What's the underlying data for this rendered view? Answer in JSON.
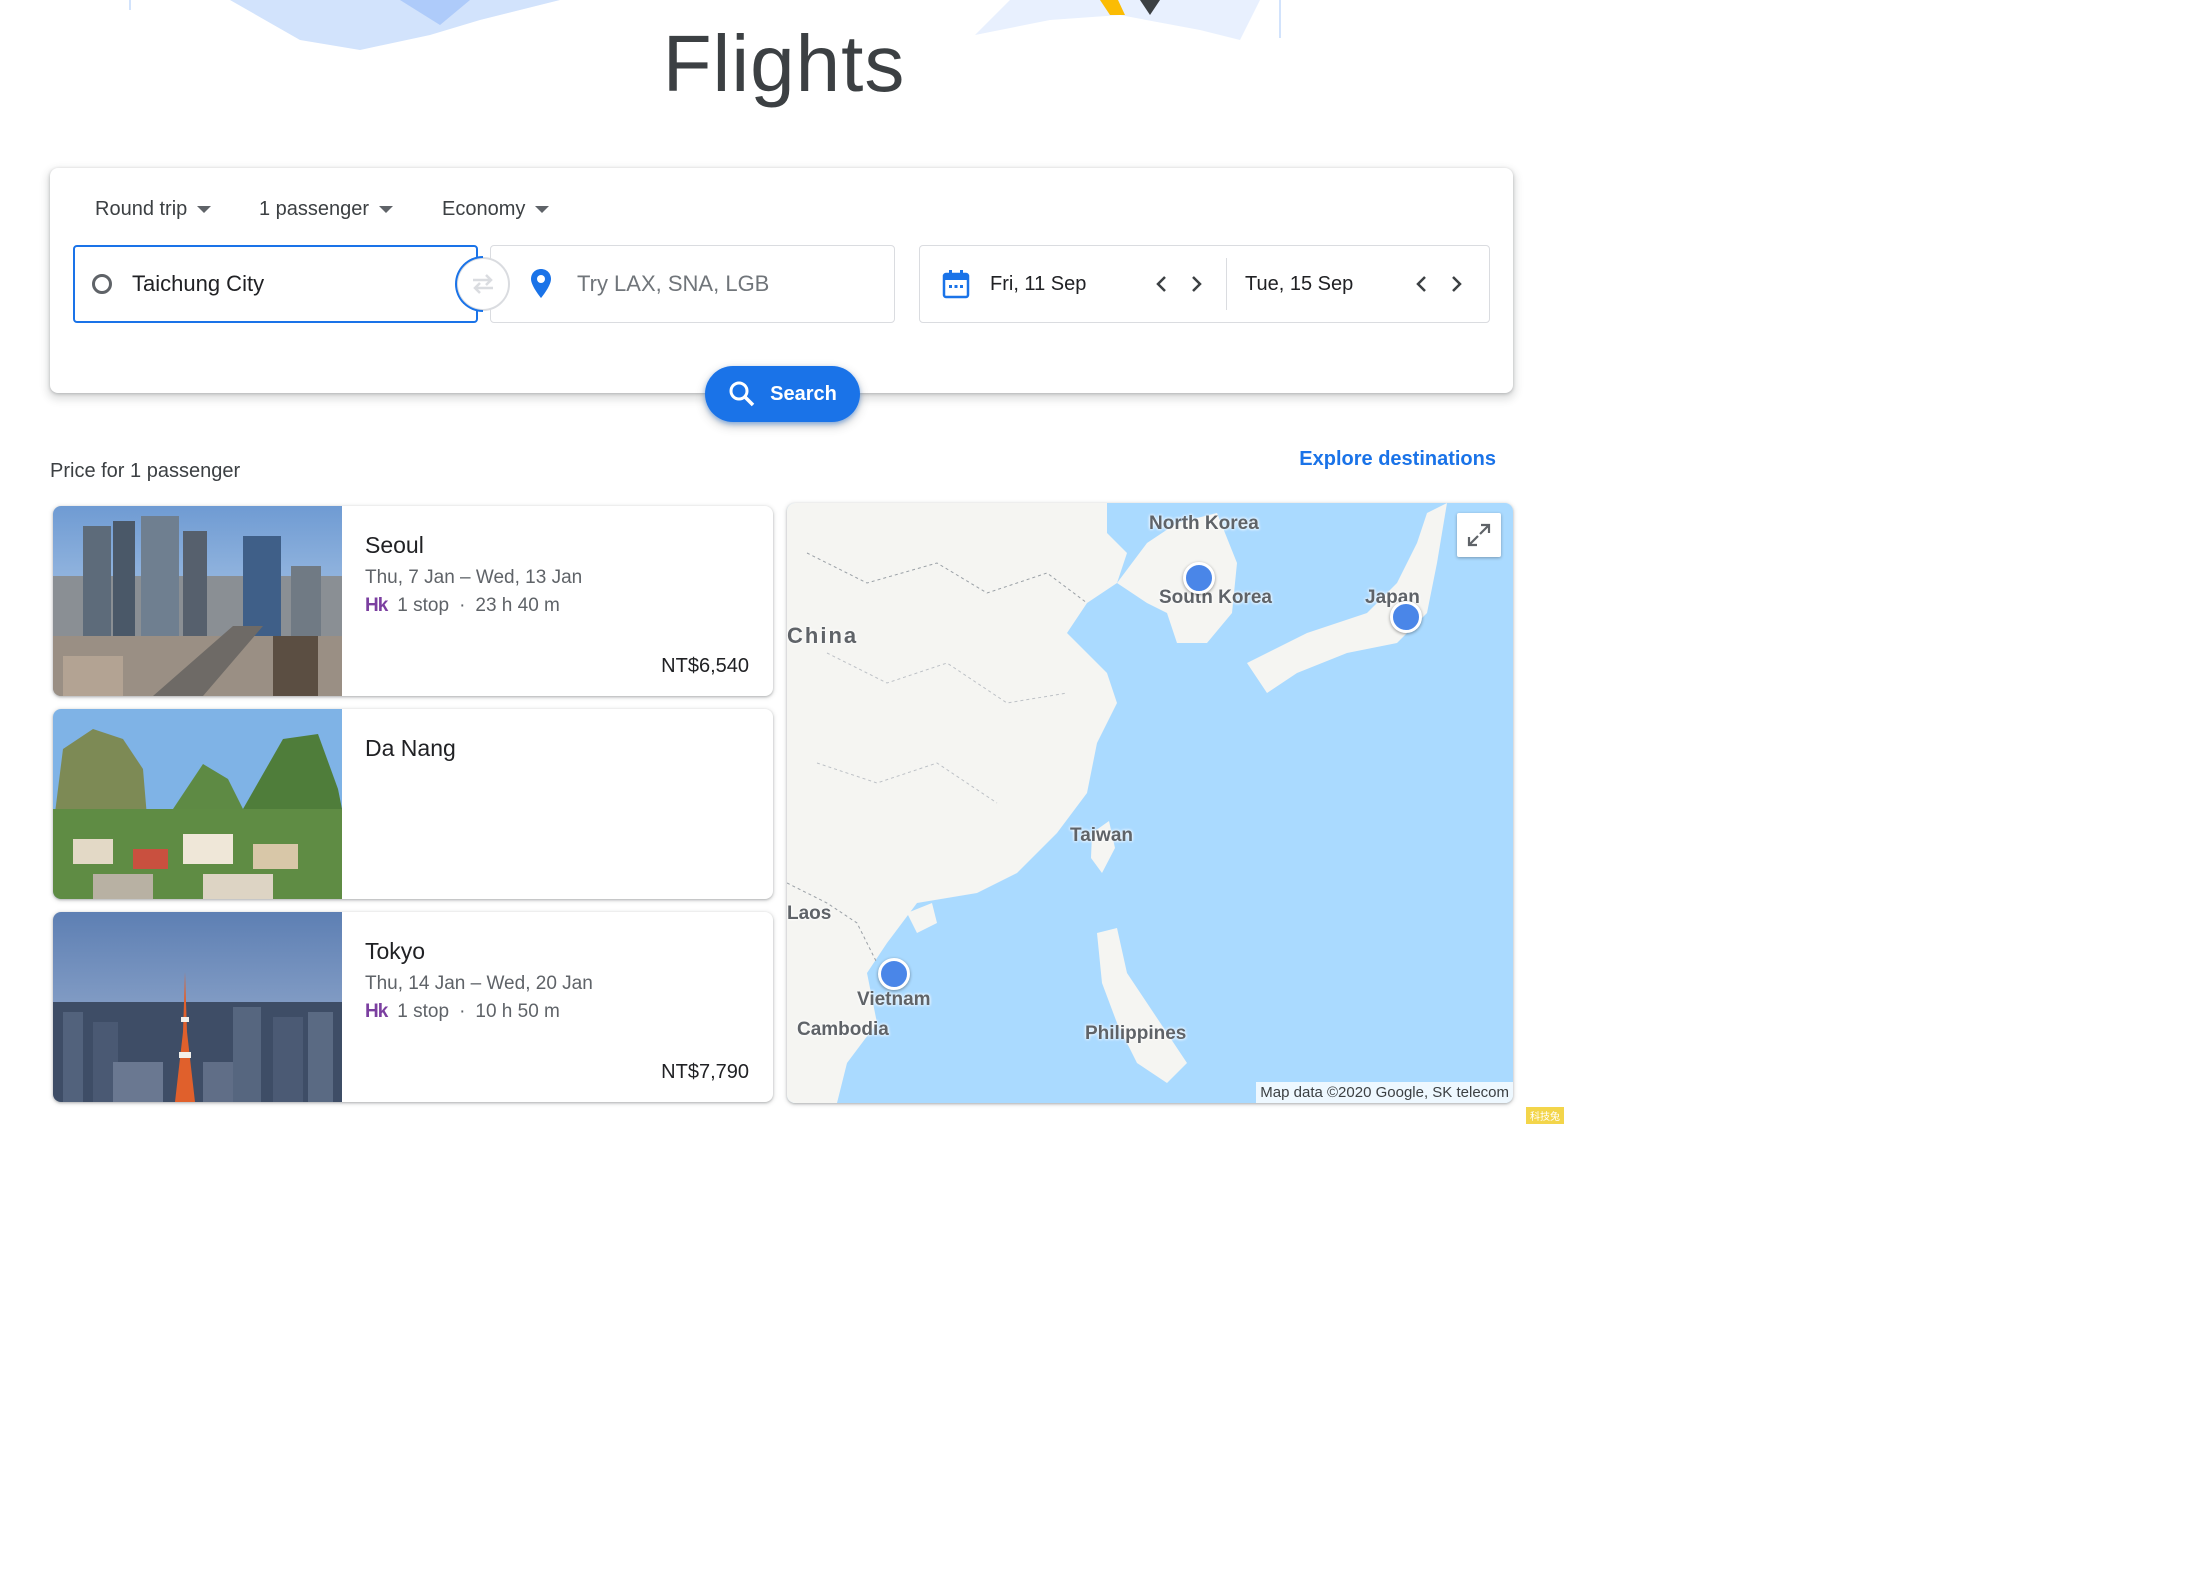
{
  "page": {
    "title": "Flights"
  },
  "search": {
    "trip_type": "Round trip",
    "passengers": "1 passenger",
    "cabin": "Economy",
    "origin": "Taichung City",
    "destination_placeholder": "Try LAX, SNA, LGB",
    "depart_date": "Fri, 11 Sep",
    "return_date": "Tue, 15 Sep",
    "search_label": "Search"
  },
  "results": {
    "price_note": "Price for 1 passenger",
    "explore_label": "Explore destinations",
    "cards": [
      {
        "city": "Seoul",
        "dates": "Thu, 7 Jan – Wed, 13 Jan",
        "airline_logo": "Hk",
        "stops": "1 stop",
        "separator": "·",
        "duration": "23 h 40 m",
        "price": "NT$6,540"
      },
      {
        "city": "Da Nang",
        "dates": "",
        "airline_logo": "",
        "stops": "",
        "separator": "",
        "duration": "",
        "price": ""
      },
      {
        "city": "Tokyo",
        "dates": "Thu, 14 Jan – Wed, 20 Jan",
        "airline_logo": "Hk",
        "stops": "1 stop",
        "separator": "·",
        "duration": "10 h 50 m",
        "price": "NT$7,790"
      }
    ]
  },
  "map": {
    "labels": {
      "north_korea": "North Korea",
      "south_korea": "South Korea",
      "japan": "Japan",
      "china": "China",
      "taiwan": "Taiwan",
      "laos": "Laos",
      "vietnam": "Vietnam",
      "cambodia": "Cambodia",
      "philippines": "Philippines"
    },
    "attribution": "Map data ©2020 Google, SK telecom"
  },
  "watermark": "科技兔",
  "colors": {
    "accent": "#1a73e8",
    "map_water": "#aadaff",
    "map_land": "#f5f5f2",
    "airline": "#7b3fa0"
  }
}
